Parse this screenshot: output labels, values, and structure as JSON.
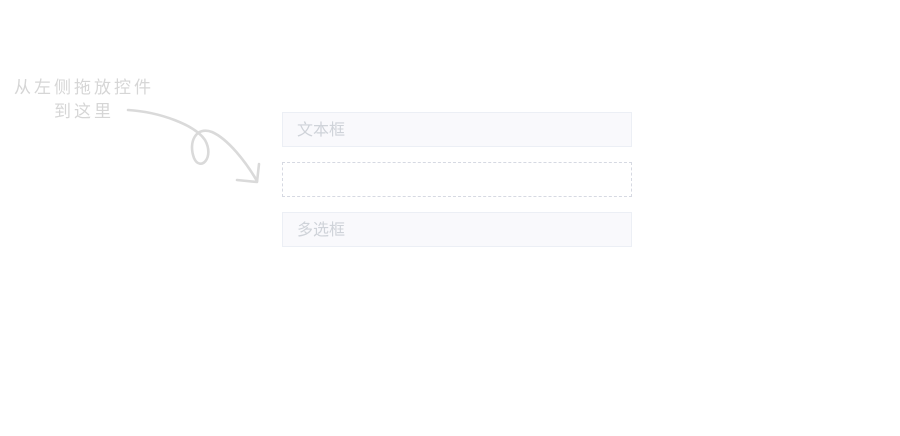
{
  "hint": {
    "line1": "从左侧拖放控件",
    "line2": "到这里"
  },
  "form": {
    "fields": [
      {
        "label": "文本框"
      },
      {
        "label": ""
      },
      {
        "label": "多选框"
      }
    ]
  },
  "colors": {
    "hint_text": "#d6d6d6",
    "field_background": "#f9f9fc",
    "field_border": "#eceff5",
    "drop_border": "#d6d9e2",
    "field_text": "#cfd3d9"
  },
  "icons": {
    "arrow": "curly-arrow-icon"
  }
}
